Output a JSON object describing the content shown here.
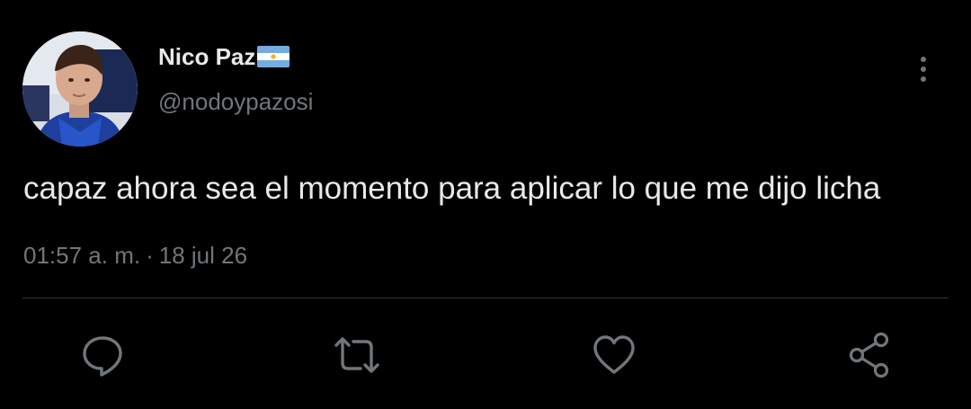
{
  "tweet": {
    "author": {
      "display_name": "Nico Paz",
      "handle": "@nodoypazosi",
      "avatar_icon": "profile-photo-icon",
      "flag_icon": "argentina-flag-icon"
    },
    "text": "capaz ahora sea el momento para aplicar lo que me dijo licha",
    "time": "01:57 a. m.",
    "separator": "·",
    "date": "18 jul 26"
  },
  "actions": {
    "reply_icon": "reply-icon",
    "retweet_icon": "retweet-icon",
    "like_icon": "heart-icon",
    "share_icon": "share-icon",
    "more_icon": "more-vertical-icon"
  },
  "colors": {
    "background": "#000000",
    "text_primary": "#e7e9ea",
    "text_secondary": "#71767b",
    "divider": "#2f3336",
    "icon": "#71767b"
  }
}
